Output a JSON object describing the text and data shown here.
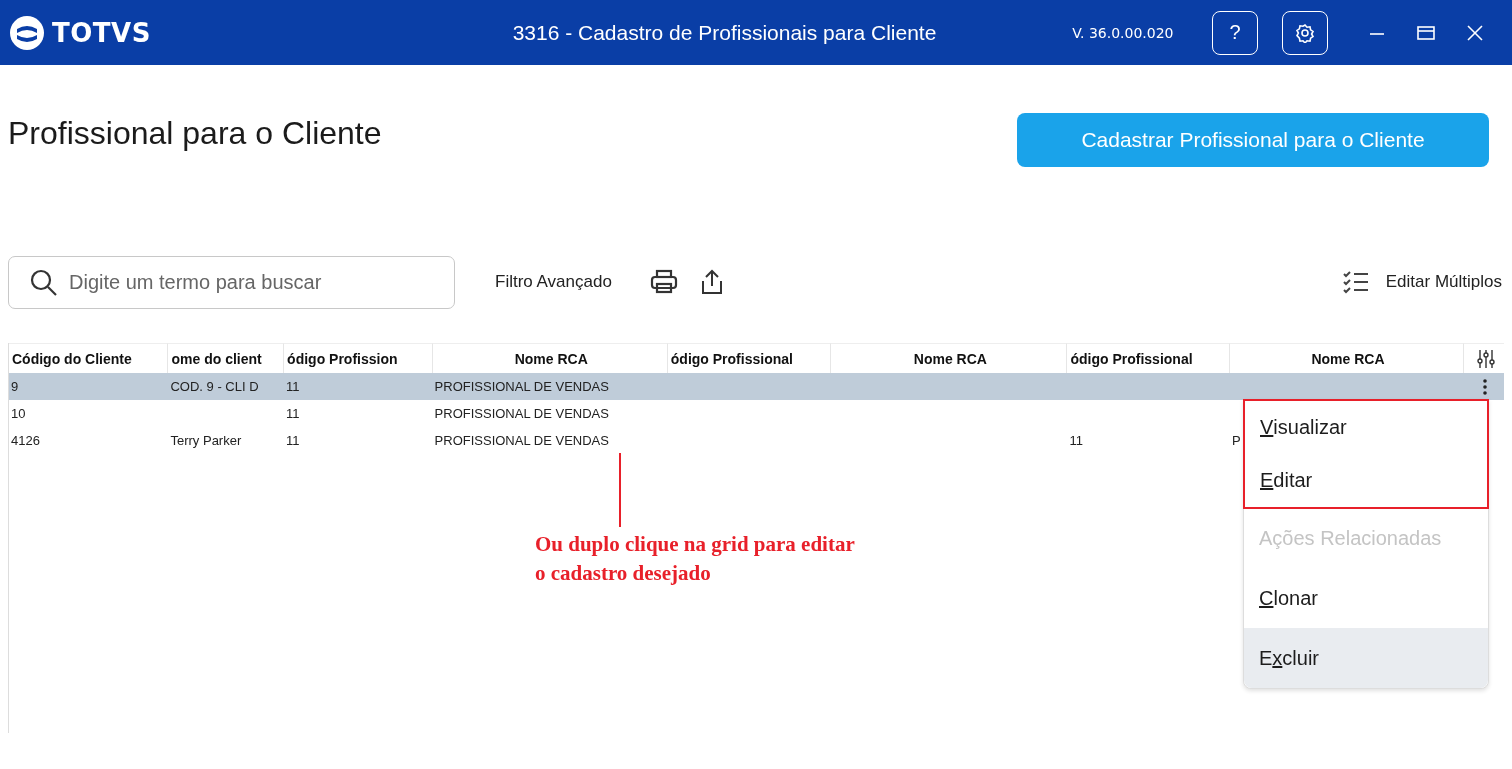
{
  "titlebar": {
    "brand": "TOTVS",
    "title": "3316 - Cadastro de Profissionais para Cliente",
    "version": "V. 36.0.00.020",
    "help": "?"
  },
  "page": {
    "heading": "Profissional para o Cliente",
    "primary_button": "Cadastrar Profissional para o Cliente"
  },
  "toolbar": {
    "search": {
      "placeholder": "Digite um termo para buscar"
    },
    "filter": "Filtro Avançado",
    "edit_multiple": "Editar Múltiplos"
  },
  "table": {
    "columns": [
      "Código do Cliente",
      "ome do client",
      "ódigo Profission",
      "Nome RCA",
      "ódigo Profissional",
      "Nome RCA",
      "ódigo Profissional",
      "Nome RCA"
    ],
    "rows": [
      {
        "selected": true,
        "cells": [
          "9",
          "COD. 9 - CLI D",
          "11",
          "PROFISSIONAL DE VENDAS",
          "",
          "",
          "",
          ""
        ]
      },
      {
        "selected": false,
        "cells": [
          "10",
          "",
          "11",
          "PROFISSIONAL DE VENDAS",
          "",
          "",
          "",
          ""
        ]
      },
      {
        "selected": false,
        "cells": [
          "4126",
          "Terry Parker",
          "11",
          "PROFISSIONAL DE VENDAS",
          "",
          "",
          "11",
          "P"
        ]
      }
    ]
  },
  "context_menu": {
    "highlighted_items": [
      {
        "key": "V",
        "after": "isualizar",
        "hovered": false
      },
      {
        "key": "E",
        "after": "ditar",
        "hovered": false
      }
    ],
    "items": [
      {
        "before": "Ações Relacionadas",
        "disabled": true,
        "hovered": false
      },
      {
        "key": "C",
        "after": "lonar",
        "disabled": false,
        "hovered": false
      },
      {
        "before": "E",
        "key": "x",
        "after": "cluir",
        "disabled": false,
        "hovered": true
      }
    ]
  },
  "annotation": {
    "text": "Ou duplo clique na grid para editar o cadastro desejado"
  }
}
